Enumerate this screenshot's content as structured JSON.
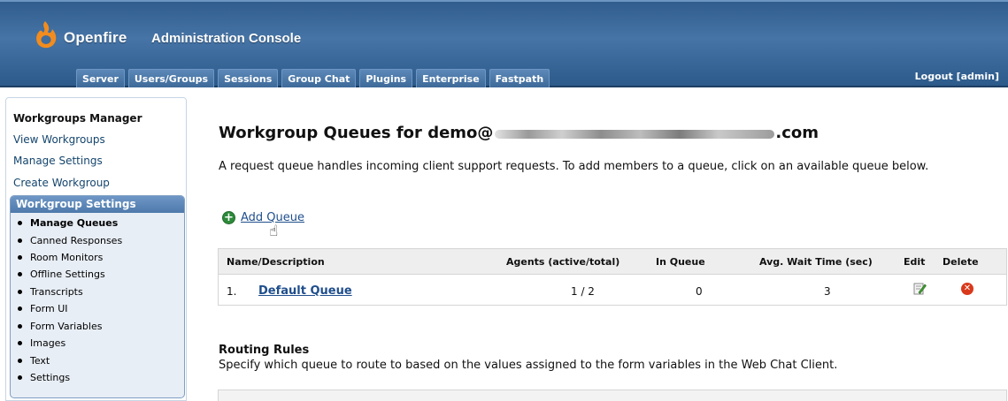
{
  "header": {
    "brand": "Openfire",
    "title": "Administration Console",
    "logout": "Logout [admin]",
    "tabs": [
      "Server",
      "Users/Groups",
      "Sessions",
      "Group Chat",
      "Plugins",
      "Enterprise",
      "Fastpath"
    ],
    "brand_color": "#3f6d9f",
    "logo_color": "#f28c1e"
  },
  "sidebar": {
    "title": "Workgroups Manager",
    "links": [
      "View Workgroups",
      "Manage Settings",
      "Create Workgroup"
    ],
    "sub_title": "Workgroup Settings",
    "sub_items": [
      "Manage Queues",
      "Canned Responses",
      "Room Monitors",
      "Offline Settings",
      "Transcripts",
      "Form UI",
      "Form Variables",
      "Images",
      "Text",
      "Settings"
    ],
    "active_item": "Manage Queues"
  },
  "main": {
    "title_prefix": "Workgroup Queues for demo@",
    "title_suffix": ".com",
    "description": "A request queue handles incoming client support requests. To add members to a queue, click on an available queue below.",
    "add_queue_label": "Add Queue",
    "table": {
      "headers": {
        "name": "Name/Description",
        "agents": "Agents (active/total)",
        "in_queue": "In Queue",
        "avg_wait": "Avg. Wait Time (sec)",
        "edit": "Edit",
        "delete": "Delete"
      },
      "rows": [
        {
          "index": "1.",
          "name": "Default Queue",
          "agents": "1 / 2",
          "in_queue": "0",
          "avg_wait": "3"
        }
      ]
    },
    "routing": {
      "title": "Routing Rules",
      "description": "Specify which queue to route to based on the values assigned to the form variables in the Web Chat Client."
    }
  }
}
